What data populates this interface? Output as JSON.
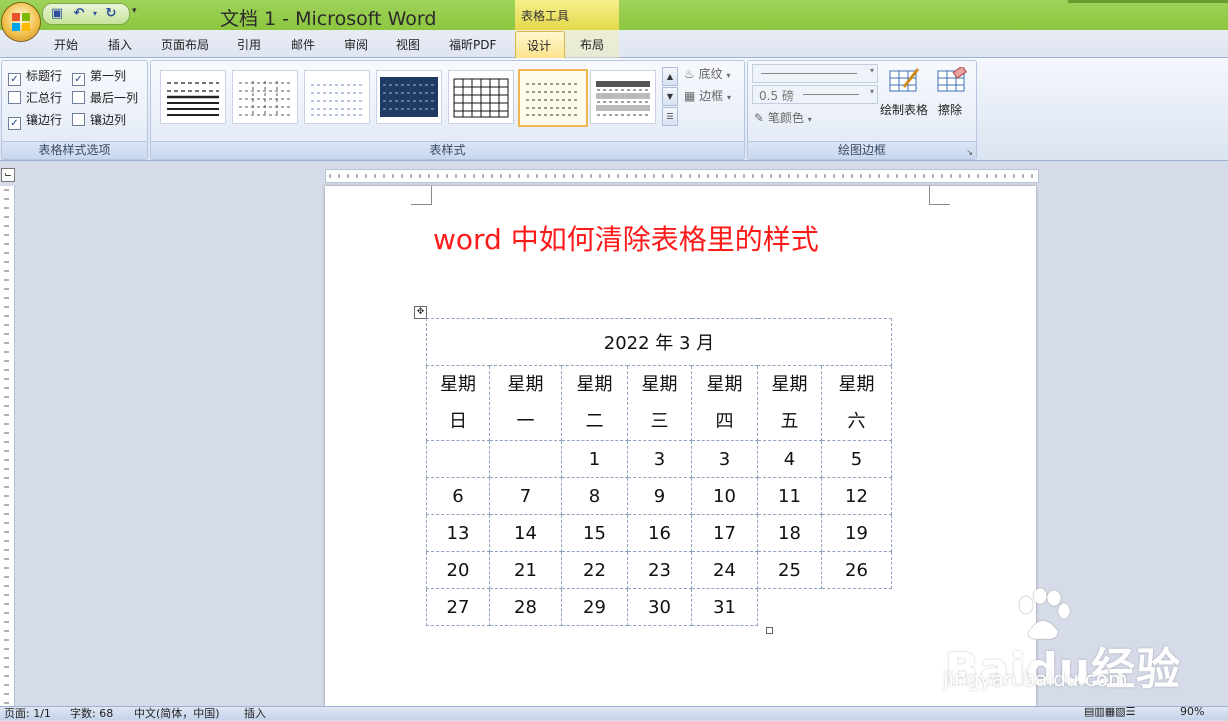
{
  "title_bar": {
    "app_title": "文档 1 - Microsoft Word",
    "context_tab_group": "表格工具"
  },
  "tabs": [
    {
      "label": "开始"
    },
    {
      "label": "插入"
    },
    {
      "label": "页面布局"
    },
    {
      "label": "引用"
    },
    {
      "label": "邮件"
    },
    {
      "label": "审阅"
    },
    {
      "label": "视图"
    },
    {
      "label": "福昕PDF"
    },
    {
      "label": "设计",
      "active": true
    },
    {
      "label": "布局"
    }
  ],
  "ribbon": {
    "style_options": {
      "group_label": "表格样式选项",
      "items": [
        {
          "label": "标题行",
          "checked": true
        },
        {
          "label": "第一列",
          "checked": true
        },
        {
          "label": "汇总行",
          "checked": false
        },
        {
          "label": "最后一列",
          "checked": false
        },
        {
          "label": "镶边行",
          "checked": true
        },
        {
          "label": "镶边列",
          "checked": false
        }
      ]
    },
    "table_styles": {
      "group_label": "表样式",
      "shading_label": "底纹",
      "borders_label": "边框"
    },
    "draw_borders": {
      "group_label": "绘图边框",
      "pen_weight": "0.5 磅",
      "pen_color_label": "笔颜色",
      "draw_table_label": "绘制表格",
      "eraser_label": "擦除"
    }
  },
  "document": {
    "heading": "word 中如何清除表格里的样式",
    "calendar": {
      "title": "2022 年 3 月",
      "weekdays": [
        [
          "星期",
          "日"
        ],
        [
          "星期",
          "一"
        ],
        [
          "星期",
          "二"
        ],
        [
          "星期",
          "三"
        ],
        [
          "星期",
          "四"
        ],
        [
          "星期",
          "五"
        ],
        [
          "星期",
          "六"
        ]
      ],
      "rows": [
        [
          "",
          "",
          "1",
          "3",
          "3",
          "4",
          "5"
        ],
        [
          "6",
          "7",
          "8",
          "9",
          "10",
          "11",
          "12"
        ],
        [
          "13",
          "14",
          "15",
          "16",
          "17",
          "18",
          "19"
        ],
        [
          "20",
          "21",
          "22",
          "23",
          "24",
          "25",
          "26"
        ],
        [
          "27",
          "28",
          "29",
          "30",
          "31"
        ]
      ]
    }
  },
  "status_bar": {
    "page": "页面: 1/1",
    "word_count": "字数: 68",
    "language": "中文(简体，中国)",
    "mode": "插入",
    "zoom": "90%"
  },
  "watermark": {
    "brand": "Baidu经验",
    "url": "jingyan.baidu.com"
  },
  "colors": {
    "title_bar": "#8cc63f",
    "heading_red": "#ff1a1a",
    "context_tab": "#e4d84a",
    "selected_style_border": "#f0b650"
  }
}
